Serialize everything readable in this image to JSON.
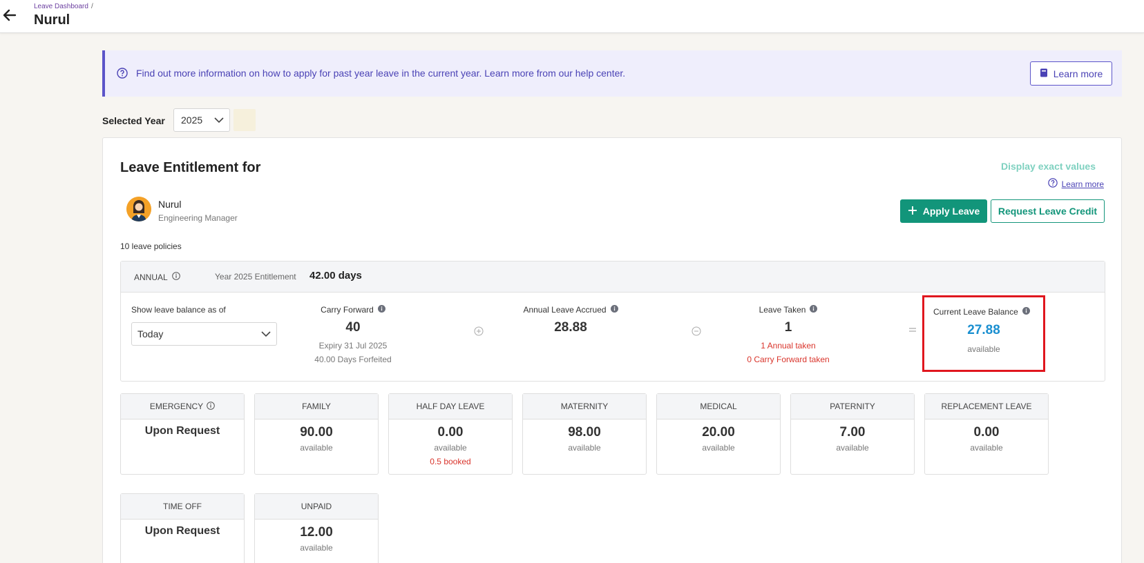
{
  "header": {
    "breadcrumb": "Leave Dashboard",
    "breadcrumb_sep": "/",
    "title": "Nurul"
  },
  "banner": {
    "message": "Find out more information on how to apply for past year leave in the current year. Learn more from our help center.",
    "button_label": "Learn more"
  },
  "year_filter": {
    "label": "Selected Year",
    "value": "2025"
  },
  "entitlement": {
    "title": "Leave Entitlement for",
    "display_exact": "Display exact values",
    "learn_more": "Learn more",
    "employee": {
      "name": "Nurul",
      "role": "Engineering Manager"
    },
    "apply_label": "Apply Leave",
    "credit_label": "Request Leave Credit",
    "policies_count": "10 leave policies",
    "annual": {
      "type": "ANNUAL",
      "entitlement_label": "Year 2025 Entitlement",
      "entitlement_value": "42.00 days",
      "as_of_label": "Show leave balance as of",
      "as_of_value": "Today",
      "carry_forward": {
        "label": "Carry Forward",
        "value": "40",
        "expiry": "Expiry 31 Jul 2025",
        "forfeited": "40.00 Days Forfeited"
      },
      "accrued": {
        "label": "Annual Leave Accrued",
        "value": "28.88"
      },
      "taken": {
        "label": "Leave Taken",
        "value": "1",
        "annual_taken": "1 Annual taken",
        "cf_taken": "0 Carry Forward taken"
      },
      "balance": {
        "label": "Current Leave Balance",
        "value": "27.88",
        "sub": "available"
      }
    },
    "policies": [
      {
        "name": "EMERGENCY",
        "value": "Upon Request"
      },
      {
        "name": "FAMILY",
        "value": "90.00",
        "sub": "available"
      },
      {
        "name": "HALF DAY LEAVE",
        "value": "0.00",
        "sub": "available",
        "booked": "0.5 booked"
      },
      {
        "name": "MATERNITY",
        "value": "98.00",
        "sub": "available"
      },
      {
        "name": "MEDICAL",
        "value": "20.00",
        "sub": "available"
      },
      {
        "name": "PATERNITY",
        "value": "7.00",
        "sub": "available"
      },
      {
        "name": "REPLACEMENT LEAVE",
        "value": "0.00",
        "sub": "available"
      },
      {
        "name": "TIME OFF",
        "value": "Upon Request"
      },
      {
        "name": "UNPAID",
        "value": "12.00",
        "sub": "available"
      }
    ]
  },
  "colors": {
    "primary_green": "#12957a",
    "purple": "#4a42b5",
    "balance_blue": "#1a8fd0",
    "highlight_red": "#e0161e"
  }
}
